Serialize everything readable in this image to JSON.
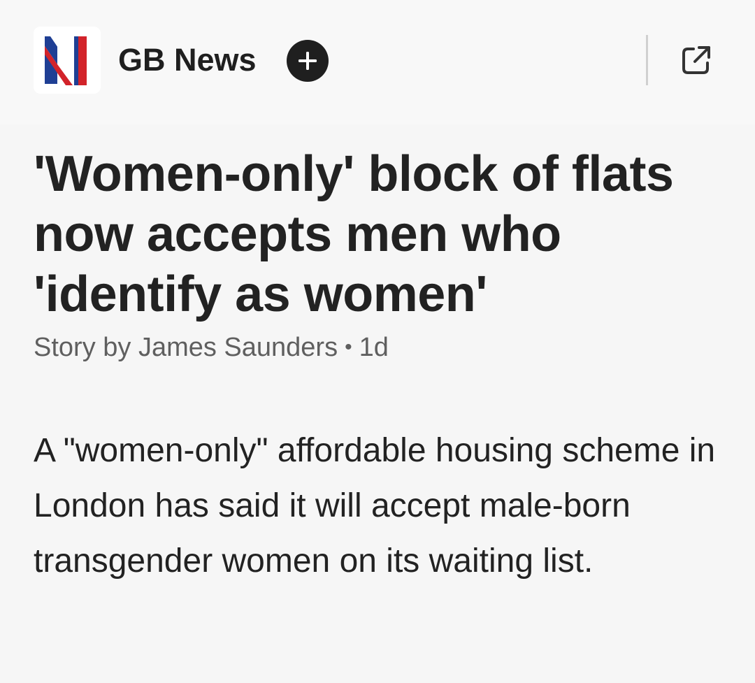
{
  "source": {
    "name": "GB News",
    "logo_icon": "gb-news-logo",
    "logo_letter": "N",
    "logo_colors": {
      "blue": "#1f3f94",
      "red": "#d2232a",
      "white": "#ffffff"
    },
    "follow_icon": "plus-circle-icon",
    "external_icon": "open-external-icon"
  },
  "article": {
    "headline": "'Women-only' block of flats now accepts men who 'identify as women'",
    "byline_author": "Story by James Saunders",
    "byline_separator": "•",
    "byline_age": "1d",
    "body": "A \"women-only\" affordable housing scheme in London has said it will accept male-born transgender women on its waiting list."
  },
  "colors": {
    "background": "#f6f6f6",
    "text": "#222222",
    "muted_text": "#5f5f5f",
    "follow_button": "#1f1f1f"
  }
}
